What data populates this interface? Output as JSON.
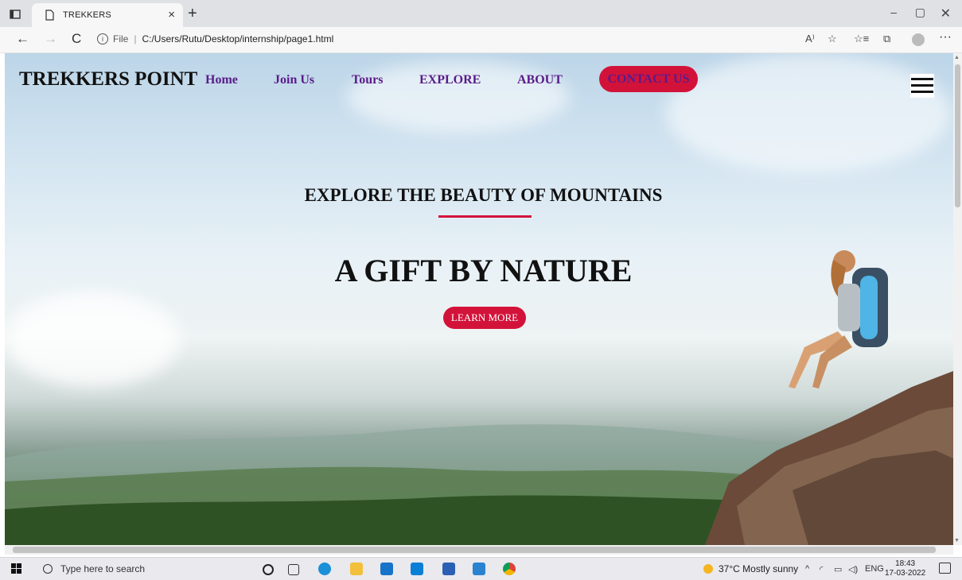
{
  "browser": {
    "tab_title": "TREKKERS",
    "tab_close": "×",
    "new_tab": "+",
    "address_info": "i",
    "address_scheme": "File",
    "address_path": "C:/Users/Rutu/Desktop/internship/page1.html",
    "window_controls": {
      "minimize": "–",
      "maximize": "▢",
      "close": "✕"
    },
    "nav": {
      "back": "←",
      "forward": "→",
      "reload": "C"
    },
    "toolbar_icons": [
      "read-aloud-icon",
      "favorites-add-icon",
      "favorites-icon",
      "collections-icon",
      "profile-icon",
      "more-icon"
    ],
    "toolbar_glyphs": {
      "read_aloud": "A⁾",
      "fav_add": "☆",
      "favorites": "☆≡",
      "collections": "⧉",
      "more": "···"
    }
  },
  "site": {
    "brand": "TREKKERS POINT",
    "nav": [
      {
        "label": "Home"
      },
      {
        "label": "Join Us"
      },
      {
        "label": "Tours"
      },
      {
        "label": "EXPLORE"
      },
      {
        "label": "ABOUT"
      }
    ],
    "contact_label": "CONTACT US",
    "hero_subtitle": "EXPLORE THE BEAUTY OF MOUNTAINS",
    "hero_title": "A GIFT BY NATURE",
    "cta_label": "LEARN MORE",
    "colors": {
      "accent": "#d3123a",
      "nav_text": "#5a1c8a",
      "heading": "#111111"
    }
  },
  "taskbar": {
    "search_placeholder": "Type here to search",
    "weather": "37°C  Mostly sunny",
    "language": "ENG",
    "time": "18:43",
    "date": "17-03-2022",
    "tray_chevron": "^",
    "pinned": [
      "cortana-icon",
      "task-view-icon",
      "edge-icon",
      "file-explorer-icon",
      "mail-icon",
      "dell-icon",
      "word-icon",
      "vscode-icon",
      "chrome-icon"
    ]
  }
}
